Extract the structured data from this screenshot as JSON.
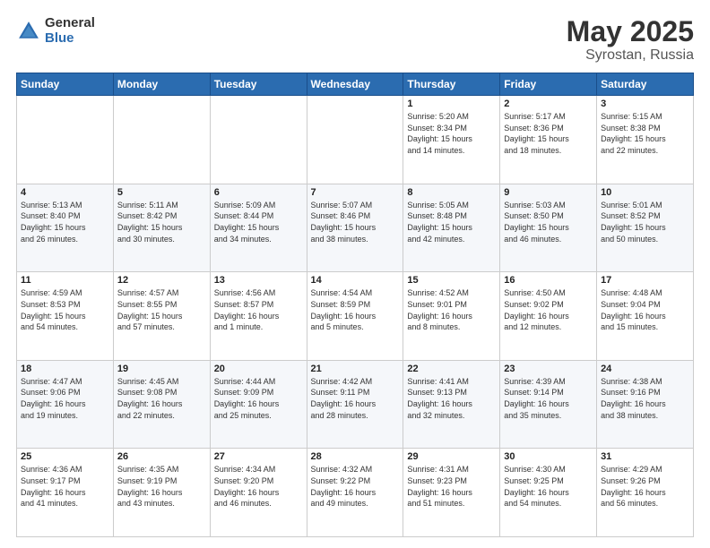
{
  "logo": {
    "general": "General",
    "blue": "Blue"
  },
  "title": {
    "month_year": "May 2025",
    "location": "Syrostan, Russia"
  },
  "days_of_week": [
    "Sunday",
    "Monday",
    "Tuesday",
    "Wednesday",
    "Thursday",
    "Friday",
    "Saturday"
  ],
  "weeks": [
    [
      {
        "day": "",
        "info": ""
      },
      {
        "day": "",
        "info": ""
      },
      {
        "day": "",
        "info": ""
      },
      {
        "day": "",
        "info": ""
      },
      {
        "day": "1",
        "info": "Sunrise: 5:20 AM\nSunset: 8:34 PM\nDaylight: 15 hours\nand 14 minutes."
      },
      {
        "day": "2",
        "info": "Sunrise: 5:17 AM\nSunset: 8:36 PM\nDaylight: 15 hours\nand 18 minutes."
      },
      {
        "day": "3",
        "info": "Sunrise: 5:15 AM\nSunset: 8:38 PM\nDaylight: 15 hours\nand 22 minutes."
      }
    ],
    [
      {
        "day": "4",
        "info": "Sunrise: 5:13 AM\nSunset: 8:40 PM\nDaylight: 15 hours\nand 26 minutes."
      },
      {
        "day": "5",
        "info": "Sunrise: 5:11 AM\nSunset: 8:42 PM\nDaylight: 15 hours\nand 30 minutes."
      },
      {
        "day": "6",
        "info": "Sunrise: 5:09 AM\nSunset: 8:44 PM\nDaylight: 15 hours\nand 34 minutes."
      },
      {
        "day": "7",
        "info": "Sunrise: 5:07 AM\nSunset: 8:46 PM\nDaylight: 15 hours\nand 38 minutes."
      },
      {
        "day": "8",
        "info": "Sunrise: 5:05 AM\nSunset: 8:48 PM\nDaylight: 15 hours\nand 42 minutes."
      },
      {
        "day": "9",
        "info": "Sunrise: 5:03 AM\nSunset: 8:50 PM\nDaylight: 15 hours\nand 46 minutes."
      },
      {
        "day": "10",
        "info": "Sunrise: 5:01 AM\nSunset: 8:52 PM\nDaylight: 15 hours\nand 50 minutes."
      }
    ],
    [
      {
        "day": "11",
        "info": "Sunrise: 4:59 AM\nSunset: 8:53 PM\nDaylight: 15 hours\nand 54 minutes."
      },
      {
        "day": "12",
        "info": "Sunrise: 4:57 AM\nSunset: 8:55 PM\nDaylight: 15 hours\nand 57 minutes."
      },
      {
        "day": "13",
        "info": "Sunrise: 4:56 AM\nSunset: 8:57 PM\nDaylight: 16 hours\nand 1 minute."
      },
      {
        "day": "14",
        "info": "Sunrise: 4:54 AM\nSunset: 8:59 PM\nDaylight: 16 hours\nand 5 minutes."
      },
      {
        "day": "15",
        "info": "Sunrise: 4:52 AM\nSunset: 9:01 PM\nDaylight: 16 hours\nand 8 minutes."
      },
      {
        "day": "16",
        "info": "Sunrise: 4:50 AM\nSunset: 9:02 PM\nDaylight: 16 hours\nand 12 minutes."
      },
      {
        "day": "17",
        "info": "Sunrise: 4:48 AM\nSunset: 9:04 PM\nDaylight: 16 hours\nand 15 minutes."
      }
    ],
    [
      {
        "day": "18",
        "info": "Sunrise: 4:47 AM\nSunset: 9:06 PM\nDaylight: 16 hours\nand 19 minutes."
      },
      {
        "day": "19",
        "info": "Sunrise: 4:45 AM\nSunset: 9:08 PM\nDaylight: 16 hours\nand 22 minutes."
      },
      {
        "day": "20",
        "info": "Sunrise: 4:44 AM\nSunset: 9:09 PM\nDaylight: 16 hours\nand 25 minutes."
      },
      {
        "day": "21",
        "info": "Sunrise: 4:42 AM\nSunset: 9:11 PM\nDaylight: 16 hours\nand 28 minutes."
      },
      {
        "day": "22",
        "info": "Sunrise: 4:41 AM\nSunset: 9:13 PM\nDaylight: 16 hours\nand 32 minutes."
      },
      {
        "day": "23",
        "info": "Sunrise: 4:39 AM\nSunset: 9:14 PM\nDaylight: 16 hours\nand 35 minutes."
      },
      {
        "day": "24",
        "info": "Sunrise: 4:38 AM\nSunset: 9:16 PM\nDaylight: 16 hours\nand 38 minutes."
      }
    ],
    [
      {
        "day": "25",
        "info": "Sunrise: 4:36 AM\nSunset: 9:17 PM\nDaylight: 16 hours\nand 41 minutes."
      },
      {
        "day": "26",
        "info": "Sunrise: 4:35 AM\nSunset: 9:19 PM\nDaylight: 16 hours\nand 43 minutes."
      },
      {
        "day": "27",
        "info": "Sunrise: 4:34 AM\nSunset: 9:20 PM\nDaylight: 16 hours\nand 46 minutes."
      },
      {
        "day": "28",
        "info": "Sunrise: 4:32 AM\nSunset: 9:22 PM\nDaylight: 16 hours\nand 49 minutes."
      },
      {
        "day": "29",
        "info": "Sunrise: 4:31 AM\nSunset: 9:23 PM\nDaylight: 16 hours\nand 51 minutes."
      },
      {
        "day": "30",
        "info": "Sunrise: 4:30 AM\nSunset: 9:25 PM\nDaylight: 16 hours\nand 54 minutes."
      },
      {
        "day": "31",
        "info": "Sunrise: 4:29 AM\nSunset: 9:26 PM\nDaylight: 16 hours\nand 56 minutes."
      }
    ]
  ]
}
